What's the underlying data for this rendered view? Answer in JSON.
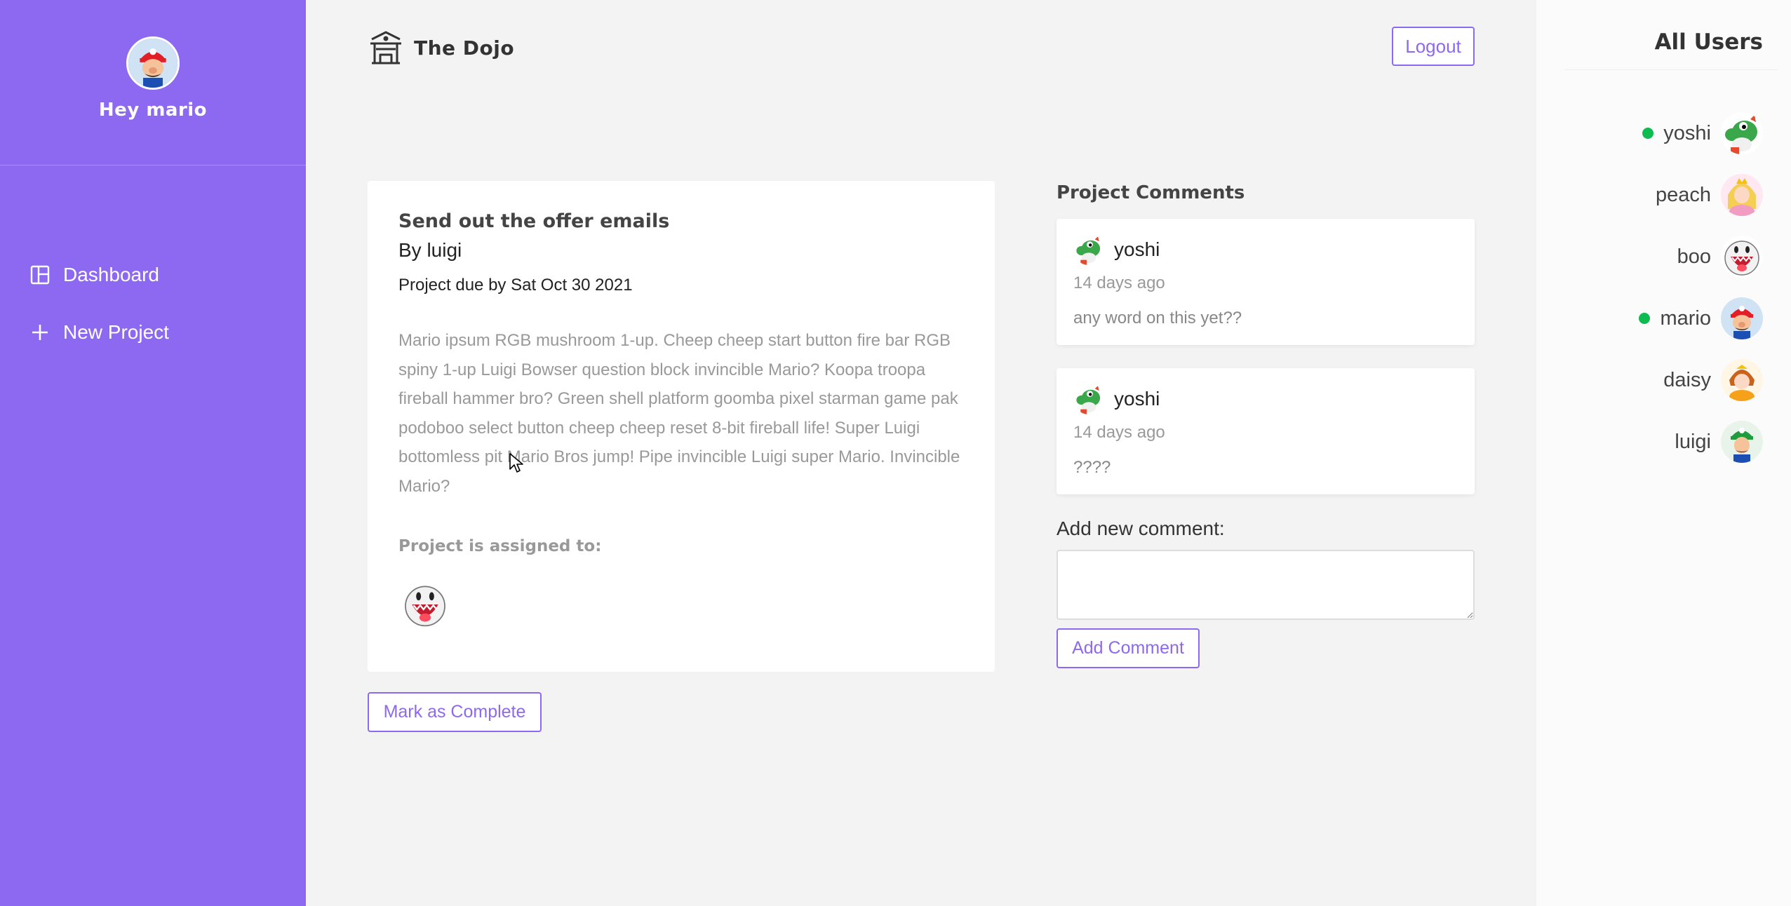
{
  "sidebar": {
    "greeting": "Hey mario",
    "avatar": "mario-avatar",
    "nav": [
      {
        "label": "Dashboard",
        "icon": "dashboard-icon"
      },
      {
        "label": "New Project",
        "icon": "plus-icon"
      }
    ]
  },
  "header": {
    "brand": "The Dojo",
    "brand_icon": "temple-icon",
    "logout_label": "Logout"
  },
  "project": {
    "title": "Send out the offer emails",
    "by": "By luigi",
    "due": "Project due by Sat Oct 30 2021",
    "details": "Mario ipsum RGB mushroom 1-up. Cheep cheep start button fire bar RGB spiny 1-up Luigi Bowser question block invincible Mario? Koopa troopa fireball hammer bro? Green shell platform goomba pixel starman game pak podoboo select button cheep cheep reset 8-bit fireball life! Super Luigi bottomless pit Mario Bros jump! Pipe invincible Luigi super Mario. Invincible Mario?",
    "assigned_heading": "Project is assigned to:",
    "assigned_users": [
      "boo-avatar"
    ],
    "complete_label": "Mark as Complete"
  },
  "comments": {
    "heading": "Project Comments",
    "items": [
      {
        "author": "yoshi",
        "date": "14 days ago",
        "content": "any word on this yet??"
      },
      {
        "author": "yoshi",
        "date": "14 days ago",
        "content": "????"
      }
    ],
    "add_label": "Add new comment:",
    "textarea_value": "",
    "add_button_label": "Add Comment"
  },
  "users": {
    "heading": "All Users",
    "list": [
      {
        "name": "yoshi",
        "online": true
      },
      {
        "name": "peach",
        "online": false
      },
      {
        "name": "boo",
        "online": false
      },
      {
        "name": "mario",
        "online": true
      },
      {
        "name": "daisy",
        "online": false
      },
      {
        "name": "luigi",
        "online": false
      }
    ]
  },
  "colors": {
    "primary": "#8d69f1",
    "online": "#0ebb50",
    "background": "#f3f3f3"
  }
}
